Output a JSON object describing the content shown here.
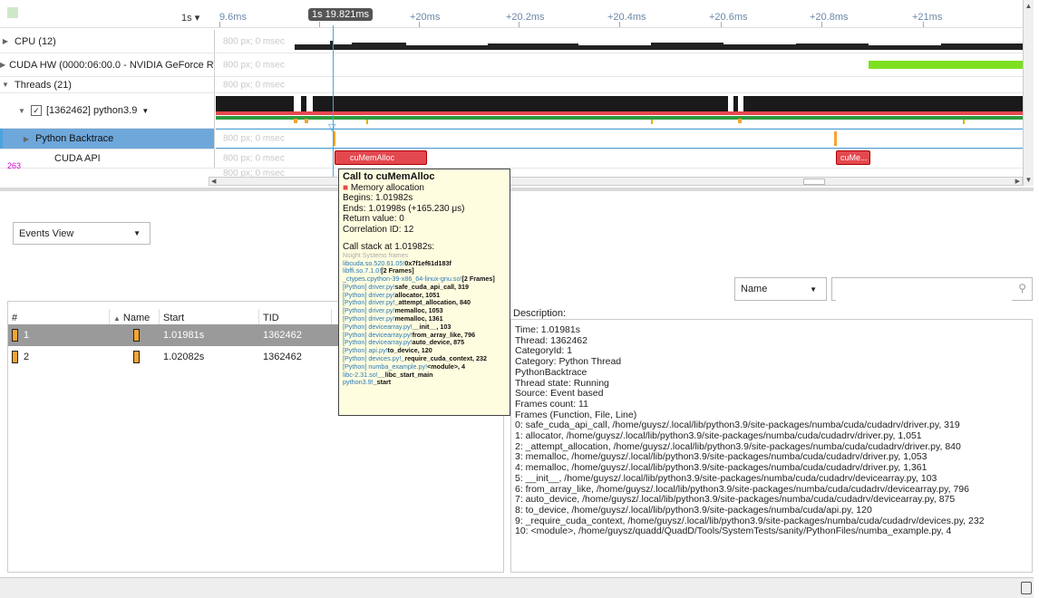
{
  "timeline": {
    "zoom_label": "1s",
    "cursor_time": "1s 19.821ms",
    "ticks": [
      "9.6ms",
      "+20ms",
      "+20.2ms",
      "+20.4ms",
      "+20.6ms",
      "+20.8ms",
      "+21ms"
    ]
  },
  "rows": {
    "cpu": "CPU (12)",
    "cuda_hw": "CUDA HW (0000:06:00.0 - NVIDIA GeForce RT",
    "threads": "Threads (21)",
    "thread_proc": "[1362462] python3.9",
    "python_backtrace": "Python Backtrace",
    "cuda_api": "CUDA API",
    "ghost_text": "800 px; 0 msec",
    "count_label": "263"
  },
  "track": {
    "cumemalloc_label": "cuMemAlloc",
    "cume_label": "cuMe..."
  },
  "tooltip": {
    "title": "Call to cuMemAlloc",
    "category": "Memory allocation",
    "begins": "Begins: 1.01982s",
    "ends": "Ends: 1.01998s (+165.230 μs)",
    "return_value": "Return value: 0",
    "correlation": "Correlation ID: 12",
    "callstack_header": "Call stack at 1.01982s:",
    "frames_title": "Nsight Systems frames",
    "stack": [
      {
        "mod": "libcuda.so.520.61.05!",
        "fn": "0x7f1ef61d183f"
      },
      {
        "mod": "libffi.so.7.1.0!",
        "fn": "[2 Frames]"
      },
      {
        "mod": "_ctypes.cpython-39-x86_64-linux-gnu.so!",
        "fn": "[2 Frames]"
      },
      {
        "mod": "[Python] driver.py!",
        "fn": "safe_cuda_api_call, 319"
      },
      {
        "mod": "[Python] driver.py!",
        "fn": "allocator, 1051"
      },
      {
        "mod": "[Python] driver.py!",
        "fn": "_attempt_allocation, 840"
      },
      {
        "mod": "[Python] driver.py!",
        "fn": "memalloc, 1053"
      },
      {
        "mod": "[Python] driver.py!",
        "fn": "memalloc, 1361"
      },
      {
        "mod": "[Python] devicearray.py!",
        "fn": "__init__, 103"
      },
      {
        "mod": "[Python] devicearray.py!",
        "fn": "from_array_like, 796"
      },
      {
        "mod": "[Python] devicearray.py!",
        "fn": "auto_device, 875"
      },
      {
        "mod": "[Python] api.py!",
        "fn": "to_device, 120"
      },
      {
        "mod": "[Python] devices.py!",
        "fn": "_require_cuda_context, 232"
      },
      {
        "mod": "[Python] numba_example.py!",
        "fn": "<module>, 4"
      },
      {
        "mod": "libc-2.31.so!",
        "fn": "__libc_start_main"
      },
      {
        "mod": "python3.9!",
        "fn": "_start"
      }
    ]
  },
  "events": {
    "view_label": "Events View",
    "columns": [
      "#",
      "Name",
      "Start",
      "TID"
    ],
    "rows": [
      {
        "num": "1",
        "start": "1.01981s",
        "tid": "1362462"
      },
      {
        "num": "2",
        "start": "1.02082s",
        "tid": "1362462"
      }
    ]
  },
  "search": {
    "field_select": "Name",
    "placeholder": ""
  },
  "description": {
    "header": "Description:",
    "lines": [
      "Time: 1.01981s",
      "Thread: 1362462",
      "CategoryId: 1",
      "Category: Python Thread",
      "PythonBacktrace",
      "Thread state: Running",
      "Source: Event based",
      "Frames count: 11",
      "Frames (Function, File, Line)",
      "0: safe_cuda_api_call, /home/guysz/.local/lib/python3.9/site-packages/numba/cuda/cudadrv/driver.py, 319",
      "1: allocator, /home/guysz/.local/lib/python3.9/site-packages/numba/cuda/cudadrv/driver.py, 1,051",
      "2: _attempt_allocation, /home/guysz/.local/lib/python3.9/site-packages/numba/cuda/cudadrv/driver.py, 840",
      "3: memalloc, /home/guysz/.local/lib/python3.9/site-packages/numba/cuda/cudadrv/driver.py, 1,053",
      "4: memalloc, /home/guysz/.local/lib/python3.9/site-packages/numba/cuda/cudadrv/driver.py, 1,361",
      "5: __init__, /home/guysz/.local/lib/python3.9/site-packages/numba/cuda/cudadrv/devicearray.py, 103",
      "6: from_array_like, /home/guysz/.local/lib/python3.9/site-packages/numba/cuda/cudadrv/devicearray.py, 796",
      "7: auto_device, /home/guysz/.local/lib/python3.9/site-packages/numba/cuda/cudadrv/devicearray.py, 875",
      "8: to_device, /home/guysz/.local/lib/python3.9/site-packages/numba/cuda/api.py, 120",
      "9: _require_cuda_context, /home/guysz/.local/lib/python3.9/site-packages/numba/cuda/cudadrv/devices.py, 232",
      "10: <module>, /home/guysz/quadd/QuadD/Tools/SystemTests/sanity/PythonFiles/numba_example.py, 4"
    ]
  },
  "colors": {
    "accent_blue": "#4aa3df",
    "green": "#7ee021",
    "red": "#e4484f",
    "selected_row": "#6ea8db",
    "tooltip_bg": "#fffde0"
  }
}
